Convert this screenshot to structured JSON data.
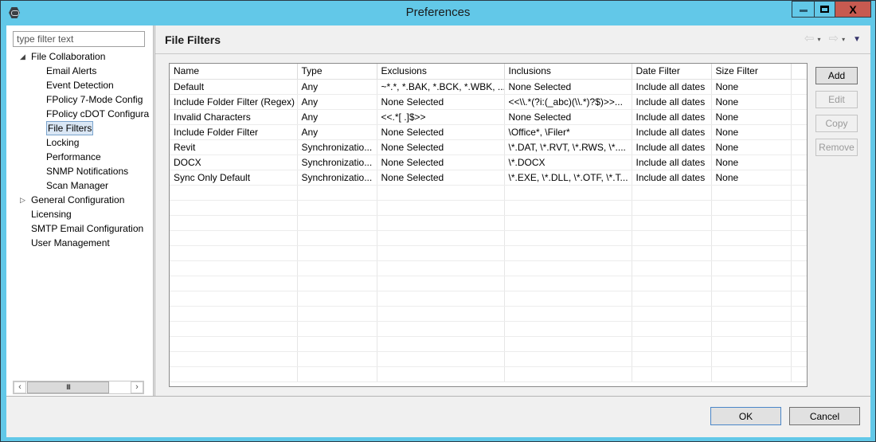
{
  "window": {
    "title": "Preferences",
    "controls": {
      "minimize": "minimize",
      "maximize": "maximize",
      "close": "X"
    }
  },
  "sidebar": {
    "filter_placeholder": "type filter text",
    "filter_value": "",
    "tree": [
      {
        "label": "File Collaboration",
        "level": 0,
        "expander": "expanded"
      },
      {
        "label": "Email Alerts",
        "level": 1
      },
      {
        "label": "Event Detection",
        "level": 1
      },
      {
        "label": "FPolicy 7-Mode Config",
        "level": 1
      },
      {
        "label": "FPolicy cDOT Configura",
        "level": 1
      },
      {
        "label": "File Filters",
        "level": 1,
        "selected": true
      },
      {
        "label": "Locking",
        "level": 1
      },
      {
        "label": "Performance",
        "level": 1
      },
      {
        "label": "SNMP Notifications",
        "level": 1
      },
      {
        "label": "Scan Manager",
        "level": 1
      },
      {
        "label": "General Configuration",
        "level": 0,
        "expander": "collapsed"
      },
      {
        "label": "Licensing",
        "level": 0
      },
      {
        "label": "SMTP Email Configuration",
        "level": 0
      },
      {
        "label": "User Management",
        "level": 0
      }
    ],
    "scrollbar": {
      "left": "‹",
      "right": "›",
      "thumb": "III"
    }
  },
  "main": {
    "title": "File Filters",
    "nav": {
      "back": "⇦",
      "forward": "⇨",
      "dropdown": "▾",
      "menu": "▼"
    },
    "table": {
      "columns": [
        "Name",
        "Type",
        "Exclusions",
        "Inclusions",
        "Date Filter",
        "Size Filter"
      ],
      "rows": [
        [
          "Default",
          "Any",
          "~*.*, *.BAK, *.BCK, *.WBK, ...",
          "None Selected",
          "Include all dates",
          "None"
        ],
        [
          "Include Folder Filter (Regex)",
          "Any",
          "None Selected",
          "<<\\\\.*(?i:(_abc)(\\\\.*)?$)>>...",
          "Include all dates",
          "None"
        ],
        [
          "Invalid Characters",
          "Any",
          "<<.*[ .]$>>",
          "None Selected",
          "Include all dates",
          "None"
        ],
        [
          "Include Folder Filter",
          "Any",
          "None Selected",
          "\\Office*, \\Filer*",
          "Include all dates",
          "None"
        ],
        [
          "Revit",
          "Synchronizatio...",
          "None Selected",
          "\\*.DAT, \\*.RVT, \\*.RWS, \\*....",
          "Include all dates",
          "None"
        ],
        [
          "DOCX",
          "Synchronizatio...",
          "None Selected",
          "\\*.DOCX",
          "Include all dates",
          "None"
        ],
        [
          "Sync Only Default",
          "Synchronizatio...",
          "None Selected",
          "\\*.EXE, \\*.DLL, \\*.OTF, \\*.T...",
          "Include all dates",
          "None"
        ]
      ]
    },
    "buttons": {
      "add": "Add",
      "edit": "Edit",
      "copy": "Copy",
      "remove": "Remove"
    }
  },
  "footer": {
    "ok": "OK",
    "cancel": "Cancel"
  }
}
